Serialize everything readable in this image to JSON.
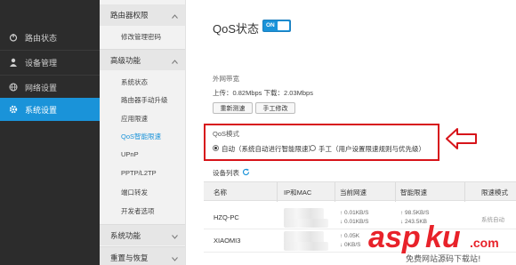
{
  "sidebar": {
    "items": [
      {
        "label": "路由状态",
        "icon": "power-icon"
      },
      {
        "label": "设备管理",
        "icon": "user-icon"
      },
      {
        "label": "网络设置",
        "icon": "globe-icon"
      },
      {
        "label": "系统设置",
        "icon": "gear-icon",
        "active": true
      }
    ]
  },
  "submenu": {
    "sections": [
      {
        "title": "路由器权限",
        "items": [
          "修改管理密码"
        ]
      },
      {
        "title": "高级功能",
        "items": [
          "系统状态",
          "路由器手动升级",
          "应用限速",
          "QoS智能限速",
          "UPnP",
          "PPTP/L2TP",
          "端口转发",
          "开发者选项"
        ]
      },
      {
        "title": "系统功能",
        "items": []
      },
      {
        "title": "重置与恢复",
        "items": []
      }
    ],
    "active_item": "QoS智能限速"
  },
  "main": {
    "title": "QoS状态",
    "toggle_label": "ON",
    "bandwidth": {
      "label": "外网带宽",
      "speed_text": "上传：0.82Mbps 下载：2.03Mbps",
      "retest_button": "重新测速",
      "manual_button": "手工修改"
    },
    "qos_mode": {
      "label": "QoS模式",
      "auto_option": "自动（系统自动进行智能限速）",
      "manual_option": "手工（用户设置限速规则与优先级）"
    },
    "device_list": {
      "label": "设备列表",
      "columns": [
        "名称",
        "IP和MAC",
        "当前网速",
        "智能限速",
        "限速模式"
      ],
      "rows": [
        {
          "name": "HZQ-PC",
          "up": "↑ 0.01KB/S",
          "down": "↓ 0.01KB/S",
          "limit_up": "↑ 98.5KB/S",
          "limit_down": "↓ 243.5KB",
          "mode": "系统自动"
        },
        {
          "name": "XIAOMI3",
          "up": "↑ 0.05K",
          "down": "↓ 0KB/S",
          "limit_up": "",
          "limit_down": "",
          "mode": ""
        }
      ]
    }
  },
  "watermark": {
    "brand": "aspku",
    "domain": ".com",
    "tagline": "免费网站源码下载站!"
  },
  "colors": {
    "accent": "#1a93d9",
    "sidebar_bg": "#2c2c2c",
    "highlight_box": "#d7141a"
  }
}
